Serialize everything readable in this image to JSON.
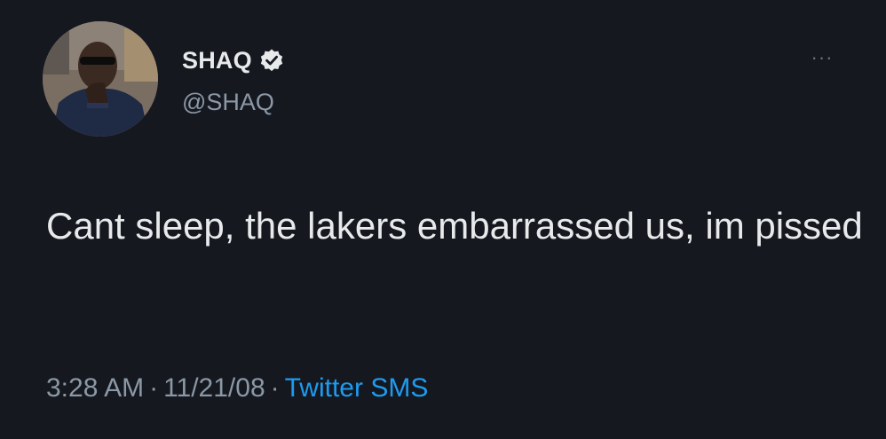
{
  "user": {
    "display_name": "SHAQ",
    "handle": "@SHAQ",
    "verified": true
  },
  "icons": {
    "verified": "verified-badge-icon",
    "more": "more-options-icon"
  },
  "more_label": "···",
  "tweet": {
    "text": "Cant sleep, the lakers embarrassed us, im pissed",
    "time": "3:28 AM",
    "date": "11/21/08",
    "source": "Twitter SMS",
    "separator": "·"
  },
  "colors": {
    "background": "#15181f",
    "text": "#e7e9ea",
    "secondary": "#8b98a5",
    "link": "#1d9bf0"
  }
}
